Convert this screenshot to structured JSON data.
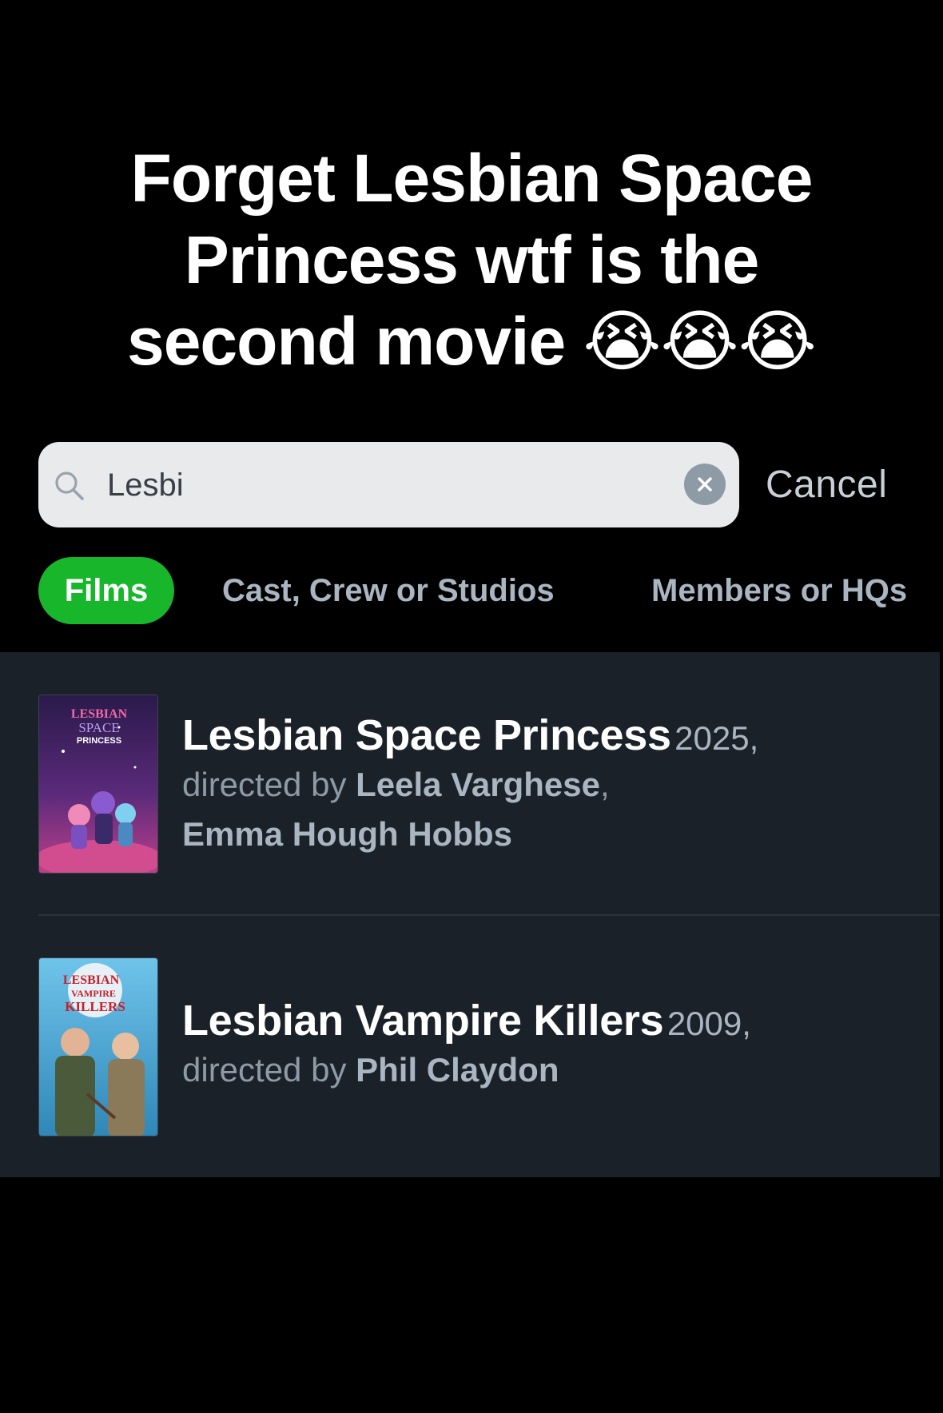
{
  "overlay": {
    "caption_line1": "Forget Lesbian Space",
    "caption_line2": "Princess wtf is the",
    "caption_line3": "second movie 😭😭😭"
  },
  "search": {
    "value": "Lesbi",
    "cancel_label": "Cancel"
  },
  "filters": {
    "films": "Films",
    "cast": "Cast, Crew or Studios",
    "members": "Members or HQs"
  },
  "results": [
    {
      "title": "Lesbian Space Princess",
      "year": "2025,",
      "directed_by": "directed by",
      "director_1": "Leela Varghese",
      "director_sep": ",",
      "director_2": "Emma Hough Hobbs",
      "poster_text": [
        "LESBIAN",
        "SPACE",
        "PRINCESS"
      ]
    },
    {
      "title": "Lesbian Vampire Killers",
      "year": "2009,",
      "directed_by": "directed by",
      "director_1": "Phil Claydon",
      "poster_text": [
        "LESBIAN",
        "VAMPIRE",
        "KILLERS"
      ]
    }
  ],
  "colors": {
    "accent_green": "#18b62a",
    "background": "#000000",
    "results_bg": "#1b2128",
    "muted_text": "#8e9aa6"
  }
}
